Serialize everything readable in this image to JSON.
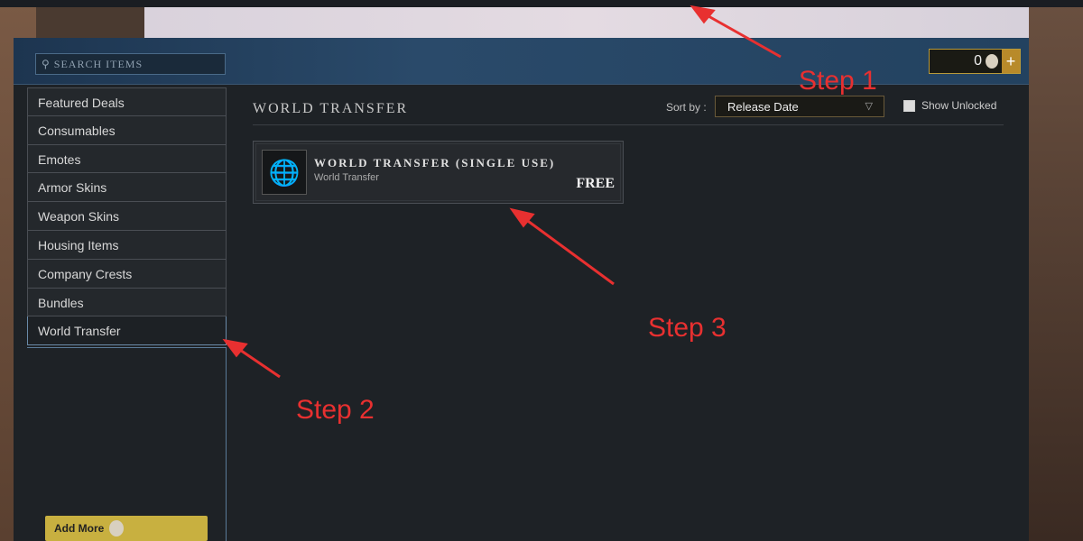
{
  "search": {
    "placeholder": "SEARCH ITEMS"
  },
  "wallet": {
    "balance": "0",
    "add": "+"
  },
  "sidebar": {
    "items": [
      {
        "label": "Featured Deals"
      },
      {
        "label": "Consumables"
      },
      {
        "label": "Emotes"
      },
      {
        "label": "Armor Skins"
      },
      {
        "label": "Weapon Skins"
      },
      {
        "label": "Housing Items"
      },
      {
        "label": "Company Crests"
      },
      {
        "label": "Bundles"
      },
      {
        "label": "World Transfer",
        "active": true
      }
    ],
    "add_more": "Add More"
  },
  "main": {
    "title": "WORLD TRANSFER",
    "sort_label": "Sort by :",
    "sort_value": "Release Date",
    "show_unlocked": "Show Unlocked",
    "card": {
      "name": "WORLD TRANSFER (SINGLE USE)",
      "category": "World Transfer",
      "price": "FREE",
      "icon": "globe-transfer-icon"
    }
  },
  "annotations": {
    "step1": "Step 1",
    "step2": "Step 2",
    "step3": "Step 3",
    "color": "#e83030"
  }
}
